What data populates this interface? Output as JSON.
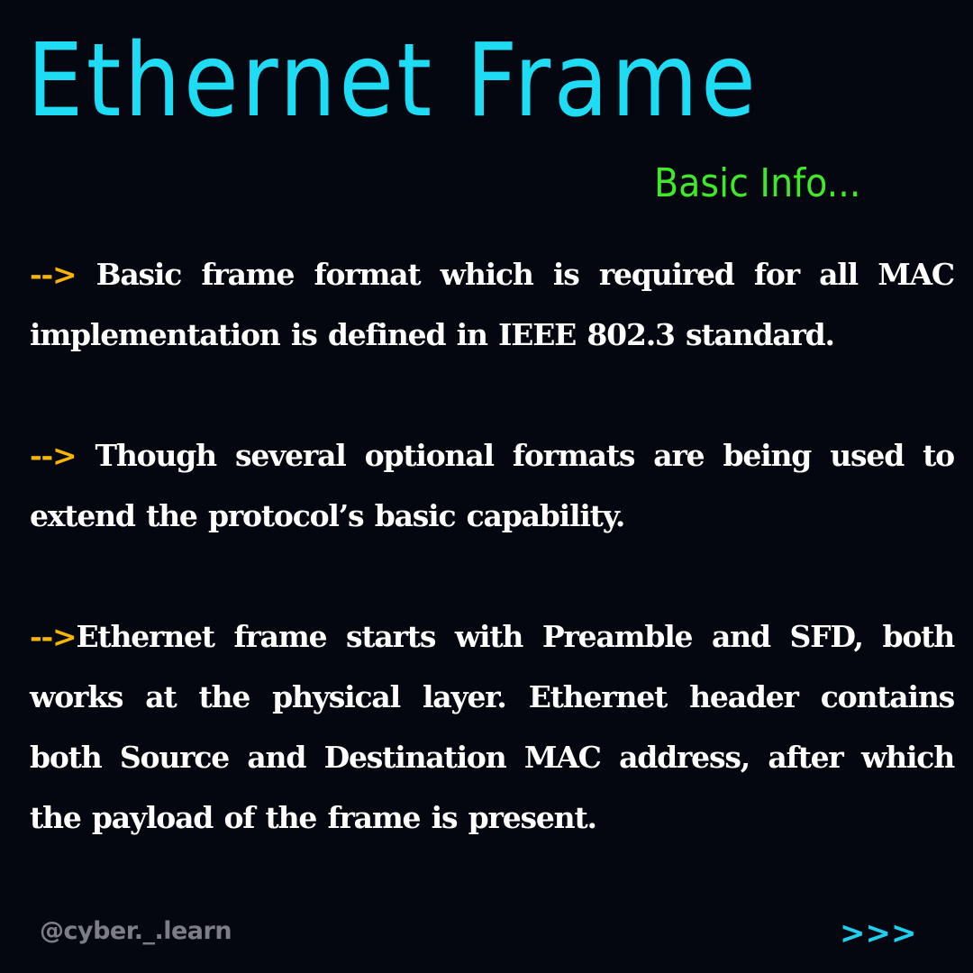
{
  "colors": {
    "background": "#04070f",
    "title": "#1fdcf5",
    "subtitle": "#3fe82a",
    "arrow": "#f6b500",
    "body_text": "#ffffff",
    "handle": "#7d7e85",
    "next_arrow": "#1fcff0"
  },
  "header": {
    "title": "Ethernet Frame",
    "subtitle": "Basic Info..."
  },
  "paragraphs": [
    {
      "arrow": "-->",
      "text": " Basic frame format which is required for all MAC implementation is defined in IEEE 802.3 standard."
    },
    {
      "arrow": "-->",
      "text": " Though several optional formats are being used to extend the protocol’s basic capability."
    },
    {
      "arrow": "-->",
      "text": "Ethernet frame starts with Preamble and SFD, both works at the physical layer. Ethernet header contains both Source and Destination MAC address, after which the payload of the frame is present."
    }
  ],
  "footer": {
    "handle": "@cyber._.learn",
    "next": ">>>"
  }
}
